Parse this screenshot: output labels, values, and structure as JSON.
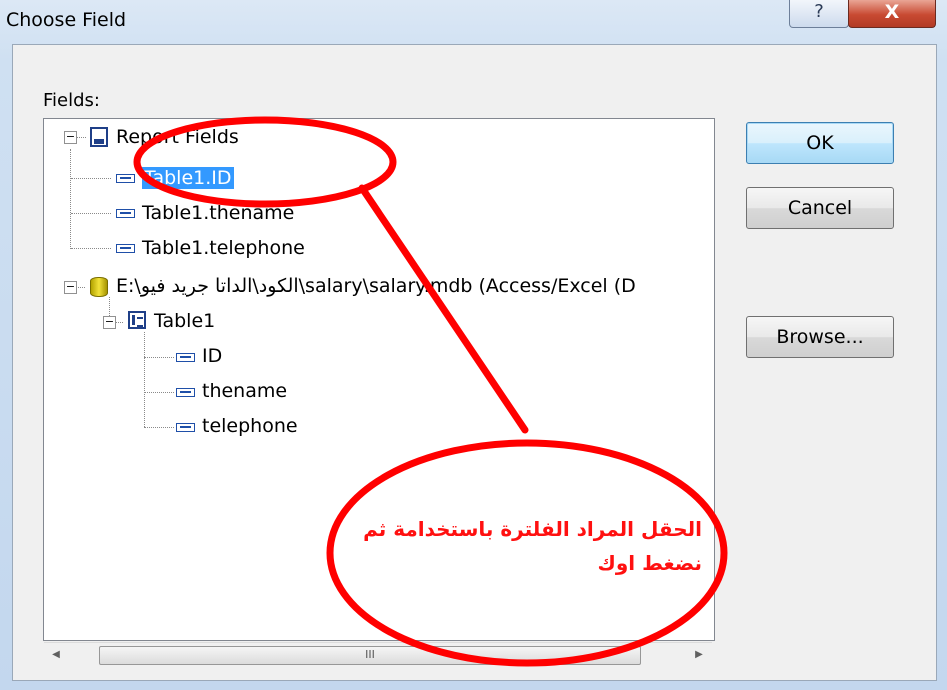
{
  "window": {
    "title": "Choose Field",
    "help_label": "?",
    "close_label": "X"
  },
  "fields_label": "Fields:",
  "tree": {
    "report_fields": "Report Fields",
    "report_items": [
      "Table1.ID",
      "Table1.thename",
      "Table1.telephone"
    ],
    "datasource": "E:\\الكود\\الداتا جريد فيو\\salary\\salary.mdb (Access/Excel (D",
    "table": "Table1",
    "table_items": [
      "ID",
      "thename",
      "telephone"
    ]
  },
  "scrollbar": {
    "left_arrow": "◀",
    "right_arrow": "▶",
    "grip": "III"
  },
  "buttons": {
    "ok": "OK",
    "cancel": "Cancel",
    "browse": "Browse..."
  },
  "annotation": {
    "line1": "الحقل المراد الفلترة باستخدامة ثم",
    "line2": "نضغط اوك",
    "color": "#ff1010"
  }
}
